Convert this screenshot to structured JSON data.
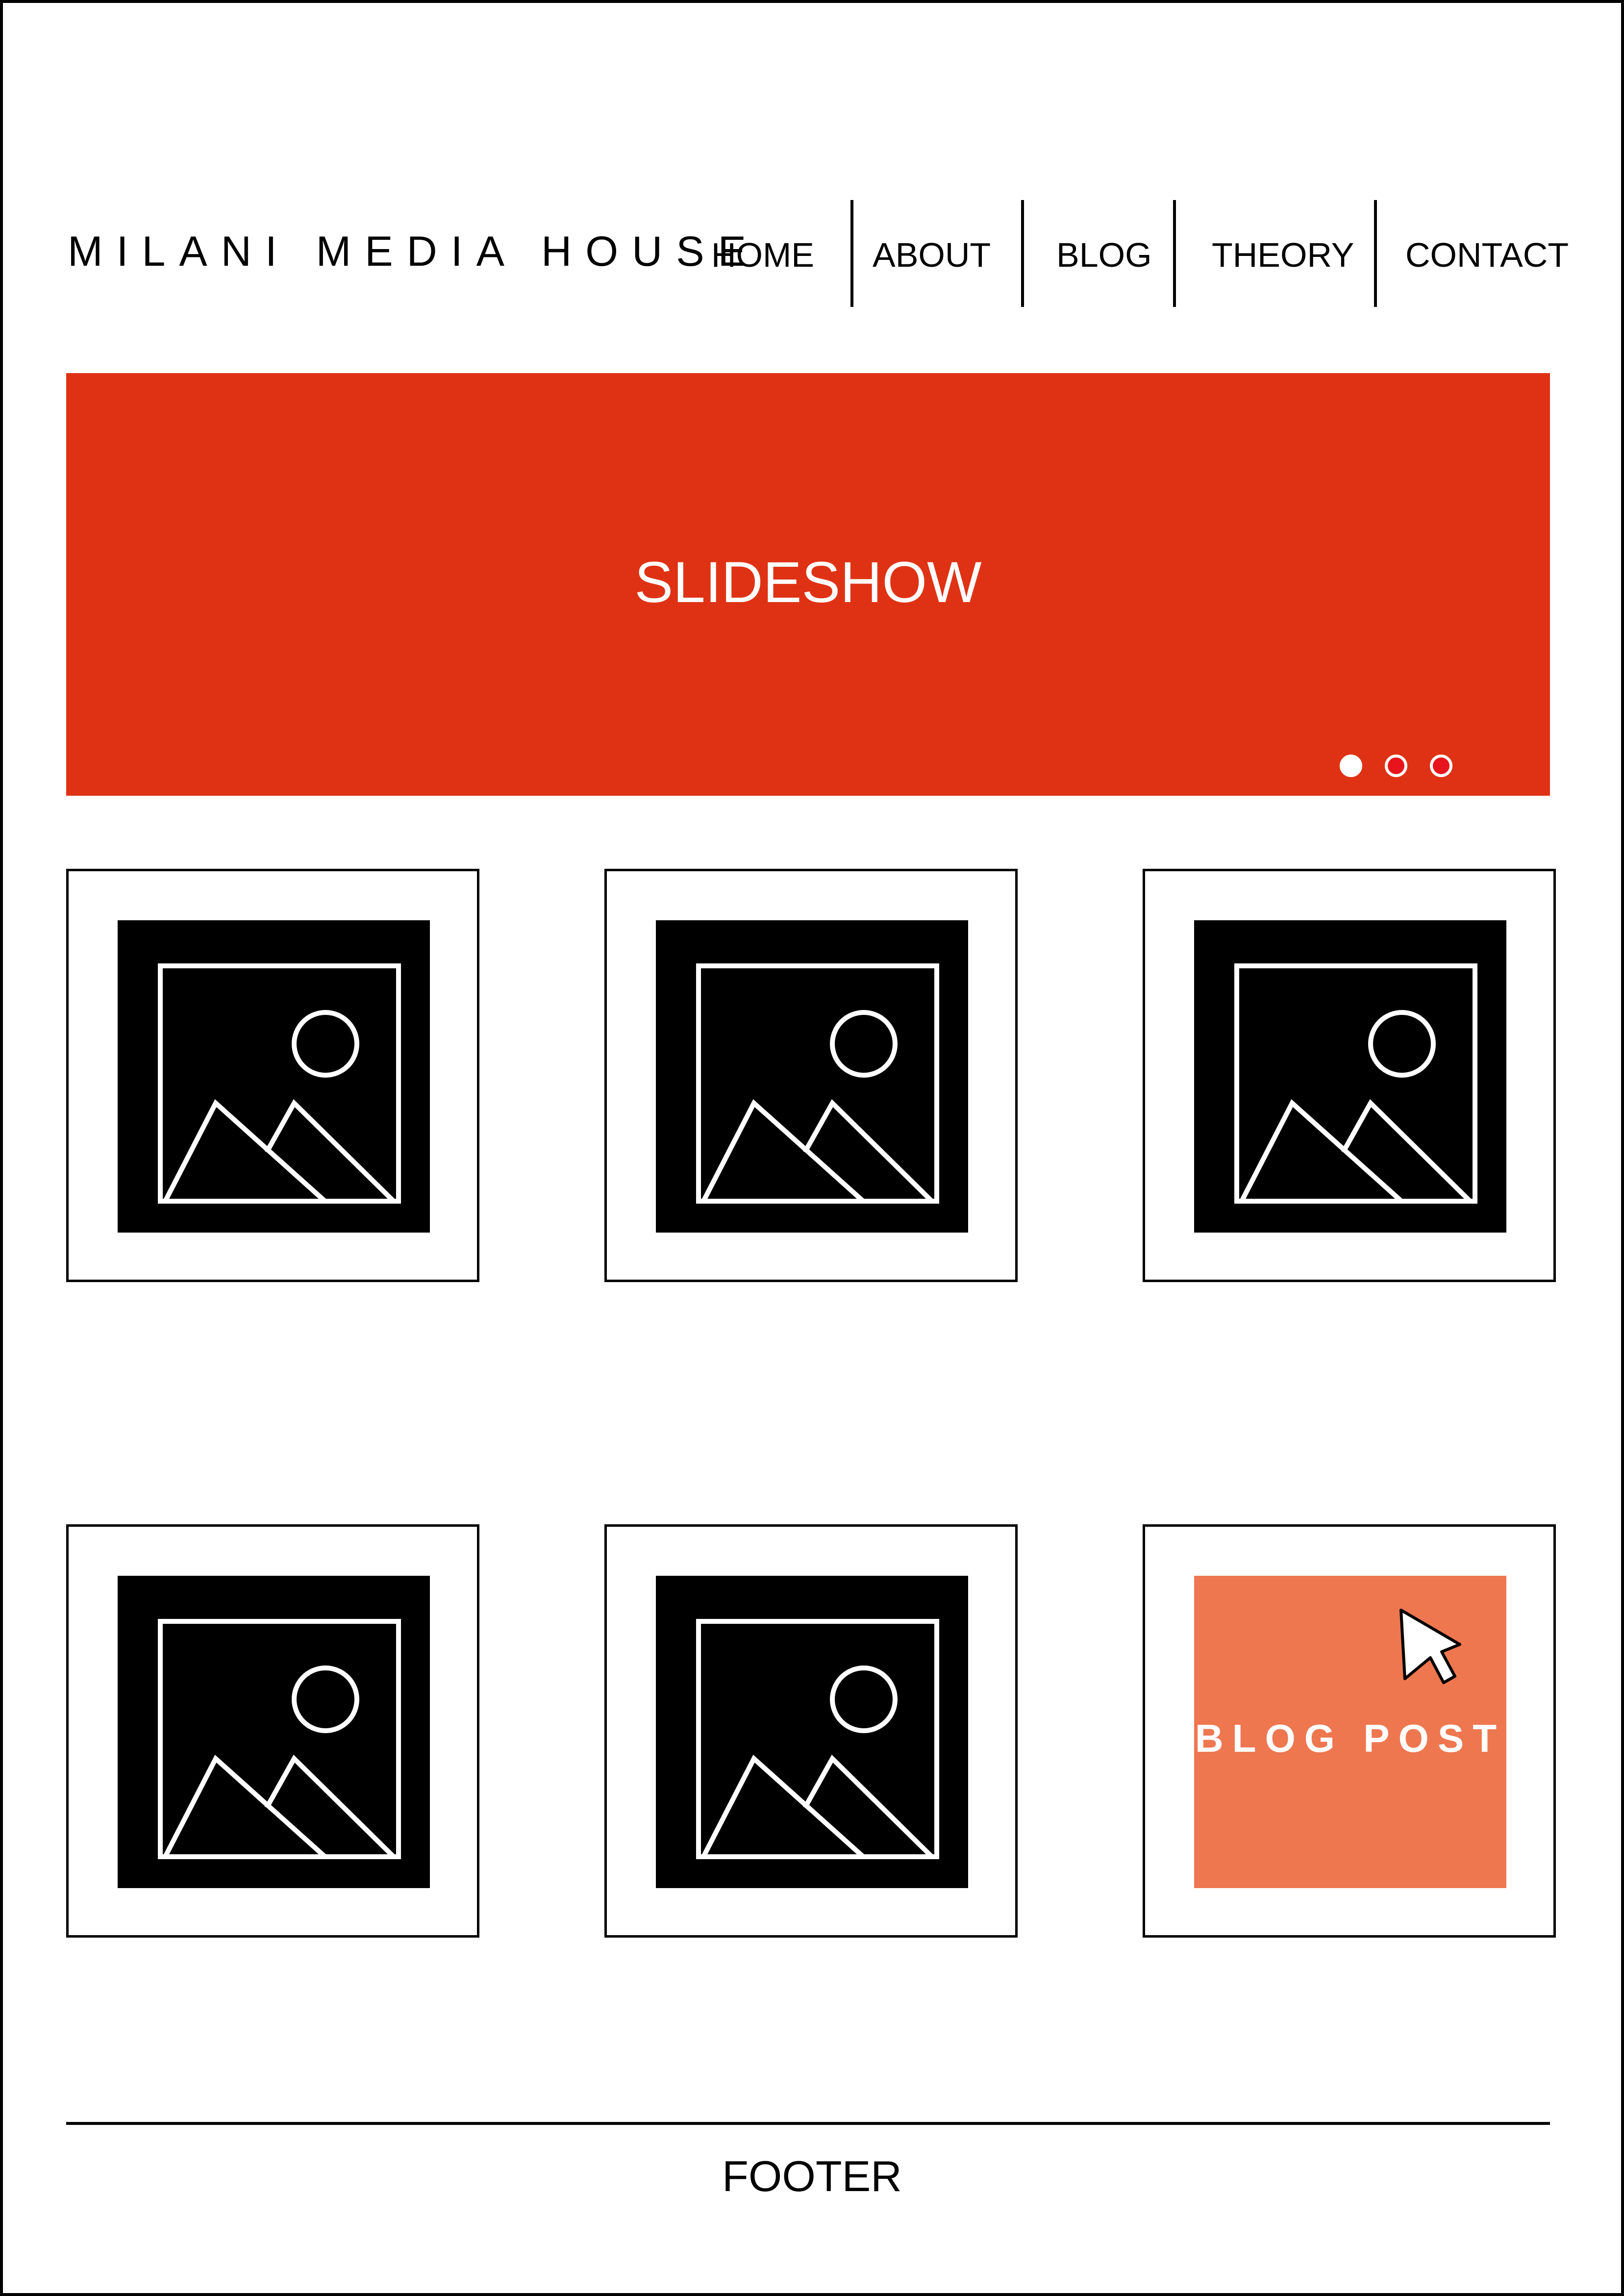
{
  "header": {
    "logo": "MILANI MEDIA HOUSE",
    "nav": [
      "HOME",
      "ABOUT",
      "BLOG",
      "THEORY",
      "CONTACT"
    ]
  },
  "slideshow": {
    "label": "SLIDESHOW",
    "slide_count": 3,
    "active_slide": 1
  },
  "cards": [
    {
      "type": "image",
      "icon": "image-placeholder-icon"
    },
    {
      "type": "image",
      "icon": "image-placeholder-icon"
    },
    {
      "type": "image",
      "icon": "image-placeholder-icon"
    },
    {
      "type": "image",
      "icon": "image-placeholder-icon"
    },
    {
      "type": "image",
      "icon": "image-placeholder-icon"
    },
    {
      "type": "blog",
      "label": "BLOG POST",
      "icon": "cursor-arrow-icon"
    }
  ],
  "footer": {
    "label": "FOOTER"
  },
  "colors": {
    "accent": "#df3214",
    "blog_tile": "#ee7750",
    "inactive_dot": "#e8141c"
  }
}
